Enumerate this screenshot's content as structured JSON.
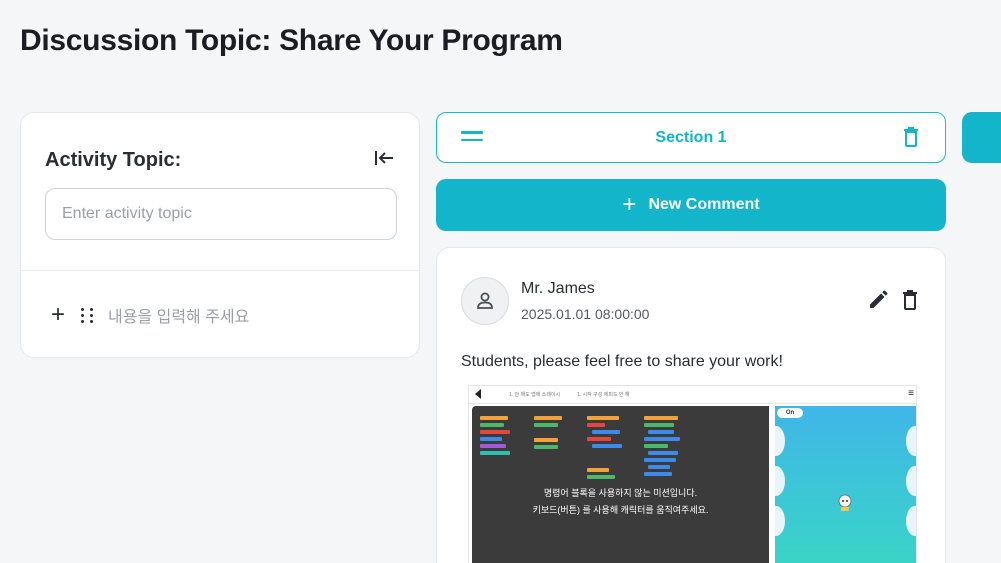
{
  "page": {
    "title": "Discussion Topic: Share Your Program"
  },
  "activity": {
    "label": "Activity Topic:",
    "input_placeholder": "Enter activity topic",
    "input_value": "",
    "content_placeholder": "내용을 입력해 주세요"
  },
  "section": {
    "title": "Section 1"
  },
  "new_comment": {
    "label": "New Comment"
  },
  "comment": {
    "author": "Mr. James",
    "timestamp": "2025.01.01 08:00:00",
    "text": "Students, please feel free to share your work!",
    "screenshot": {
      "overlay_line1": "명령어 블록을 사용하지 않는 미션입니다.",
      "overlay_line2": "키보드(버튼) 를 사용해 캐릭터를 움직여주세요.",
      "stage_toggle": "On",
      "tab1": "1. 안 해도 앱에 스레이시",
      "tab2": "1. 시작 구성 에피드 안 해"
    }
  },
  "colors": {
    "accent": "#12b5c9",
    "background": "#f5f6f8",
    "card": "#ffffff"
  },
  "icons": {
    "collapse": "collapse-left-icon",
    "plus": "plus-icon",
    "drag": "drag-handle-icon",
    "section_handle": "hamburger-icon",
    "trash": "trash-icon",
    "edit": "pencil-icon",
    "avatar": "user-icon"
  }
}
